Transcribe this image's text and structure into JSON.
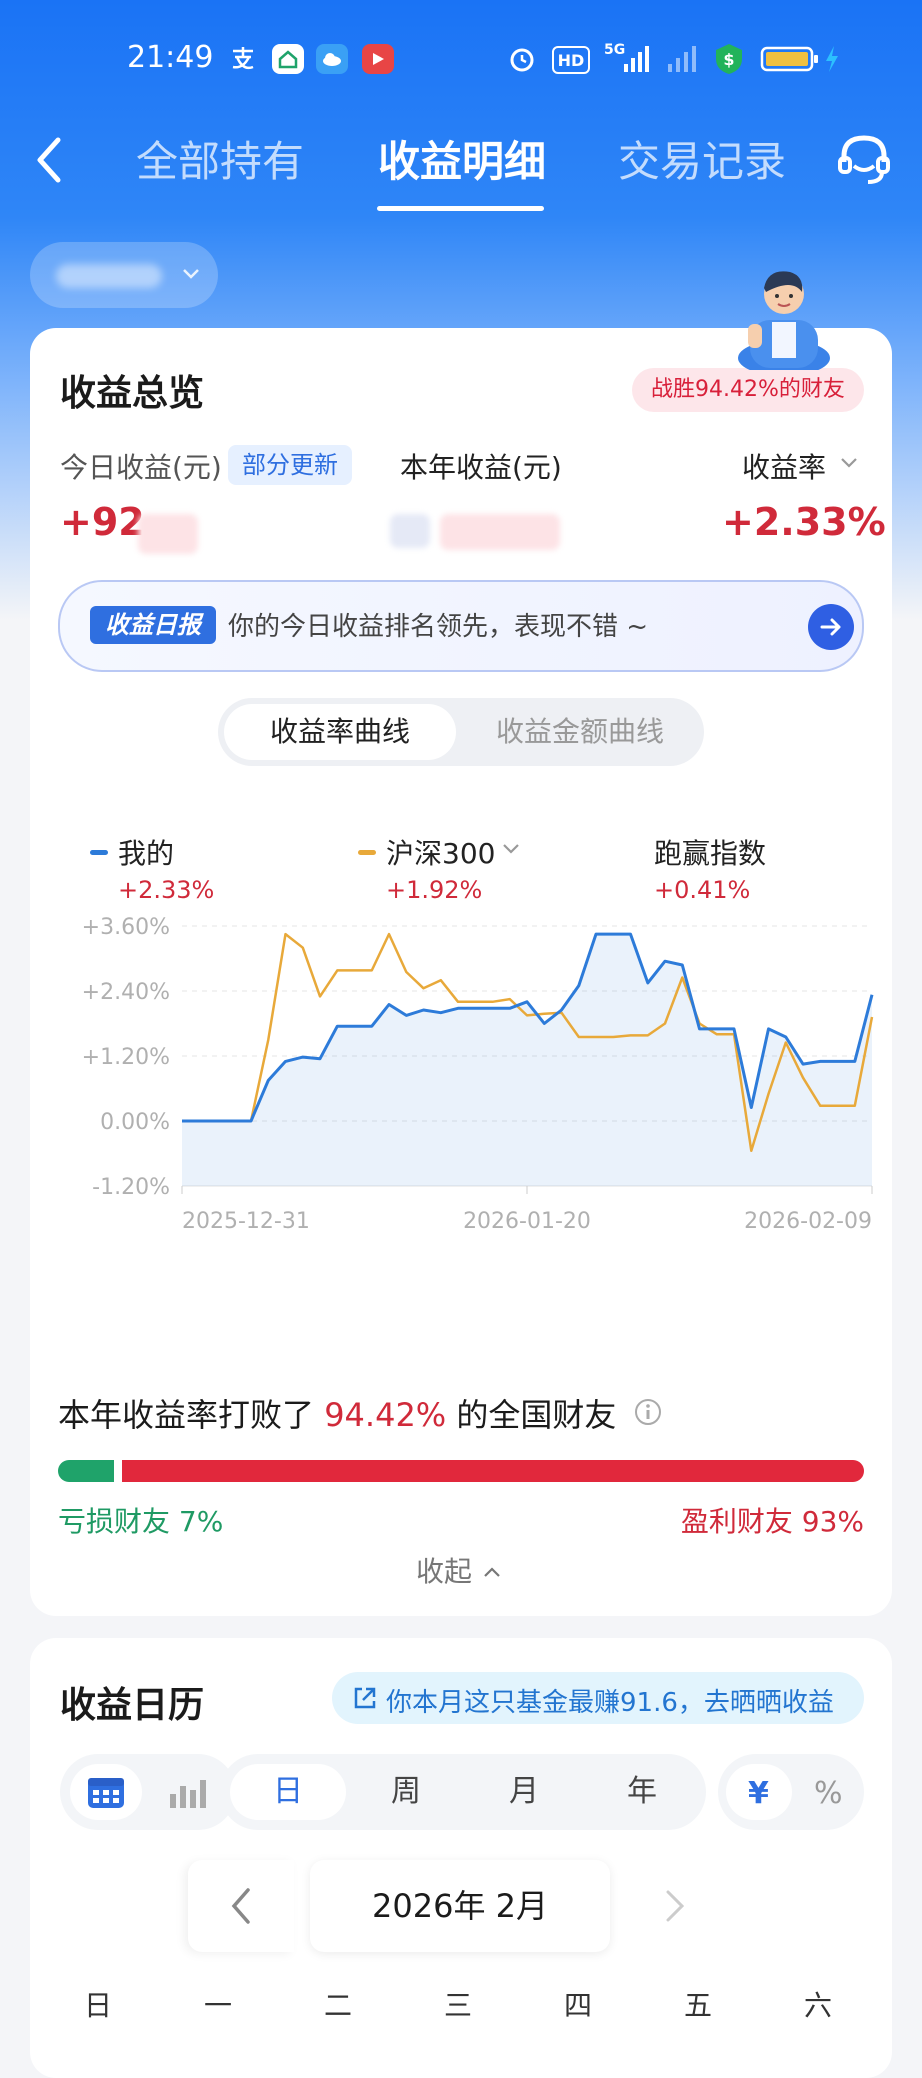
{
  "status_bar": {
    "time": "21:49",
    "icons": [
      "alipay-icon",
      "app-icon",
      "weather-icon",
      "video-icon",
      "alarm-icon",
      "hd-icon",
      "5g-signal-icon",
      "signal-icon",
      "security-icon",
      "battery-icon",
      "charging-icon"
    ],
    "hd": "HD",
    "fiveg": "5G"
  },
  "nav": {
    "tabs": [
      {
        "label": "全部持有"
      },
      {
        "label": "收益明细"
      },
      {
        "label": "交易记录"
      }
    ],
    "active_tab": 1
  },
  "overview": {
    "title": "收益总览",
    "rank_badge": "战胜94.42%的财友",
    "today_label": "今日收益(元)",
    "partial_badge": "部分更新",
    "today_value": "+92",
    "year_label": "本年收益(元)",
    "rate_label": "收益率",
    "rate_value": "+2.33%",
    "report_tag": "收益日报",
    "report_text": "你的今日收益排名领先，表现不错 ~",
    "seg_rate": "收益率曲线",
    "seg_amount": "收益金额曲线"
  },
  "legend": [
    {
      "name": "我的",
      "value": "+2.33%",
      "color": "#2d7bd9"
    },
    {
      "name": "沪深300",
      "value": "+1.92%",
      "color": "#e8a93a"
    },
    {
      "name": "跑赢指数",
      "value": "+0.41%"
    }
  ],
  "chart_data": {
    "type": "line",
    "yticks": [
      "+3.60%",
      "+2.40%",
      "+1.20%",
      "0.00%",
      "-1.20%"
    ],
    "ylim": [
      -1.2,
      3.6
    ],
    "xticks": [
      "2025-12-31",
      "2026-01-20",
      "2026-02-09"
    ],
    "series": [
      {
        "name": "我的",
        "color": "#2d7bd9",
        "values": [
          0,
          0,
          0,
          0,
          0,
          0.75,
          1.1,
          1.18,
          1.15,
          1.75,
          1.75,
          1.75,
          2.15,
          1.95,
          2.05,
          2.0,
          2.08,
          2.08,
          2.08,
          2.08,
          2.2,
          1.8,
          2.05,
          2.5,
          3.45,
          3.45,
          3.45,
          2.55,
          2.95,
          2.88,
          1.7,
          1.7,
          1.7,
          0.25,
          1.7,
          1.55,
          1.05,
          1.1,
          1.1,
          1.1,
          2.33
        ]
      },
      {
        "name": "沪深300",
        "color": "#e8a93a",
        "values": [
          0,
          0,
          0,
          0,
          0,
          1.5,
          3.45,
          3.2,
          2.3,
          2.78,
          2.78,
          2.78,
          3.45,
          2.75,
          2.45,
          2.6,
          2.2,
          2.2,
          2.2,
          2.25,
          1.95,
          1.98,
          2.0,
          1.55,
          1.55,
          1.55,
          1.58,
          1.58,
          1.8,
          2.65,
          1.8,
          1.6,
          1.6,
          -0.55,
          0.5,
          1.45,
          0.8,
          0.28,
          0.28,
          0.28,
          1.92
        ]
      }
    ]
  },
  "beat": {
    "prefix": "本年收益率打败了",
    "percent": "94.42%",
    "suffix": "的全国财友",
    "loss_label": "亏损财友 7%",
    "gain_label": "盈利财友 93%",
    "loss_fraction": 0.07,
    "collapse": "收起"
  },
  "calendar": {
    "title": "收益日历",
    "share_text": "你本月这只基金最赚91.6，去晒晒收益",
    "periods": [
      "日",
      "周",
      "月",
      "年"
    ],
    "active_period": 0,
    "unit_yuan": "¥",
    "unit_pct": "%",
    "month": "2026年 2月",
    "weekdays": [
      "日",
      "一",
      "二",
      "三",
      "四",
      "五",
      "六"
    ]
  }
}
